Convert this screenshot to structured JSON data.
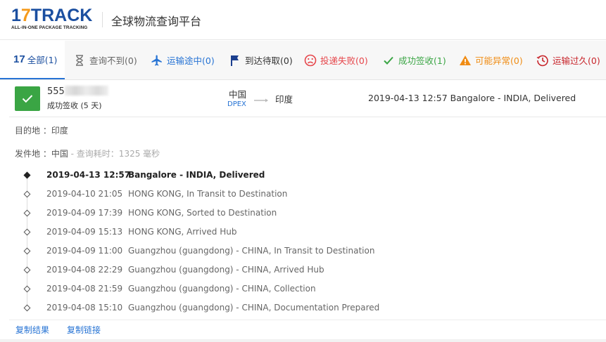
{
  "header": {
    "logo_main": "17TRACK",
    "logo_sub": "ALL-IN-ONE PACKAGE TRACKING",
    "title": "全球物流查询平台"
  },
  "tabs": [
    {
      "label": "全部(1)",
      "icon": "17-logo-icon",
      "active": true
    },
    {
      "label": "查询不到(0)",
      "icon": "hourglass-icon"
    },
    {
      "label": "运输途中(0)",
      "icon": "airplane-icon"
    },
    {
      "label": "到达待取(0)",
      "icon": "flag-icon"
    },
    {
      "label": "投递失败(0)",
      "icon": "sad-face-icon"
    },
    {
      "label": "成功签收(1)",
      "icon": "checkmark-icon"
    },
    {
      "label": "可能异常(0)",
      "icon": "warning-icon"
    },
    {
      "label": "运输过久(0)",
      "icon": "clock-history-icon"
    }
  ],
  "summary": {
    "tracking_prefix": "555",
    "status": "成功签收 (5 天)",
    "origin": "中国",
    "carrier": "DPEX",
    "destination": "印度",
    "latest_event": "2019-04-13 12:57  Bangalore - INDIA, Delivered"
  },
  "details": {
    "destination_label": "目的地 ：",
    "destination_value": "印度",
    "origin_label": "发件地 ：",
    "origin_value": "中国",
    "query_time": " - 查询耗时：1325 毫秒"
  },
  "events": [
    {
      "time": "2019-04-13 12:57",
      "desc": "Bangalore - INDIA, Delivered"
    },
    {
      "time": "2019-04-10 21:05",
      "desc": "HONG KONG, In Transit to Destination"
    },
    {
      "time": "2019-04-09 17:39",
      "desc": "HONG KONG, Sorted to Destination"
    },
    {
      "time": "2019-04-09 15:13",
      "desc": "HONG KONG, Arrived Hub"
    },
    {
      "time": "2019-04-09 11:00",
      "desc": "Guangzhou (guangdong) - CHINA, In Transit to Destination"
    },
    {
      "time": "2019-04-08 22:29",
      "desc": "Guangzhou (guangdong) - CHINA, Arrived Hub"
    },
    {
      "time": "2019-04-08 21:59",
      "desc": "Guangzhou (guangdong) - CHINA, Collection"
    },
    {
      "time": "2019-04-08 15:10",
      "desc": "Guangzhou (guangdong) - CHINA, Documentation Prepared"
    }
  ],
  "actions": {
    "copy_result": "复制结果",
    "copy_link": "复制链接"
  },
  "colors": {
    "brand_blue": "#1b4fa0",
    "link_blue": "#2673d4",
    "success_green": "#3aa544",
    "fail_red": "#e6454a",
    "warning_orange": "#f08c14"
  }
}
